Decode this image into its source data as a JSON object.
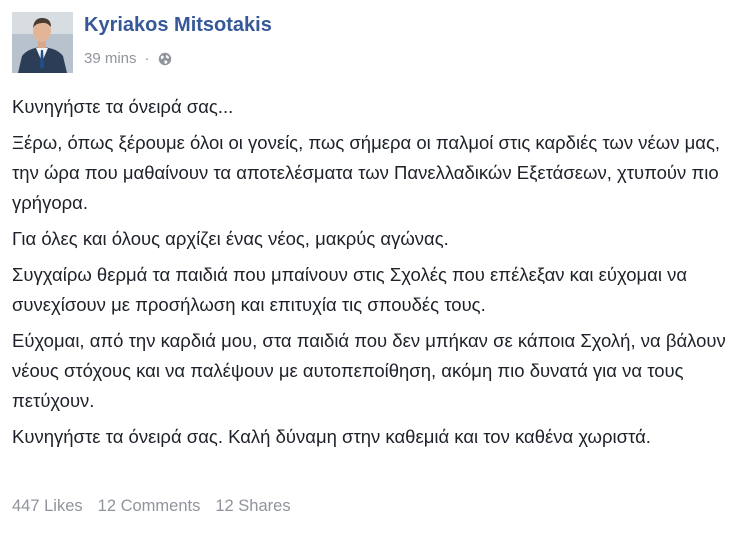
{
  "header": {
    "author": "Kyriakos Mitsotakis",
    "timestamp": "39 mins",
    "separator": "·",
    "privacy_icon": "globe-icon"
  },
  "post": {
    "paragraphs": [
      "Κυνηγήστε τα όνειρά σας...",
      "Ξέρω, όπως ξέρουμε όλοι οι γονείς, πως σήμερα οι παλμοί στις καρδιές των νέων μας, την ώρα που μαθαίνουν τα αποτελέσματα των Πανελλαδικών Εξετάσεων, χτυπούν πιο γρήγορα.",
      "Για όλες και όλους αρχίζει ένας νέος, μακρύς αγώνας.",
      "Συγχαίρω θερμά τα παιδιά που μπαίνουν στις Σχολές που επέλεξαν και εύχομαι να συνεχίσουν με προσήλωση και επιτυχία τις σπουδές τους.",
      "Εύχομαι, από την καρδιά μου, στα παιδιά που δεν μπήκαν σε κάποια Σχολή, να βάλουν νέους στόχους και να παλέψουν με αυτοπεποίθηση, ακόμη πιο δυνατά για να τους πετύχουν.",
      "Κυνηγήστε τα όνειρά σας. Καλή δύναμη στην καθεμιά και τον καθένα χωριστά."
    ]
  },
  "stats": {
    "likes": "447 Likes",
    "comments": "12 Comments",
    "shares": "12 Shares"
  },
  "colors": {
    "author": "#365899",
    "text": "#1d2129",
    "meta": "#90949c"
  }
}
